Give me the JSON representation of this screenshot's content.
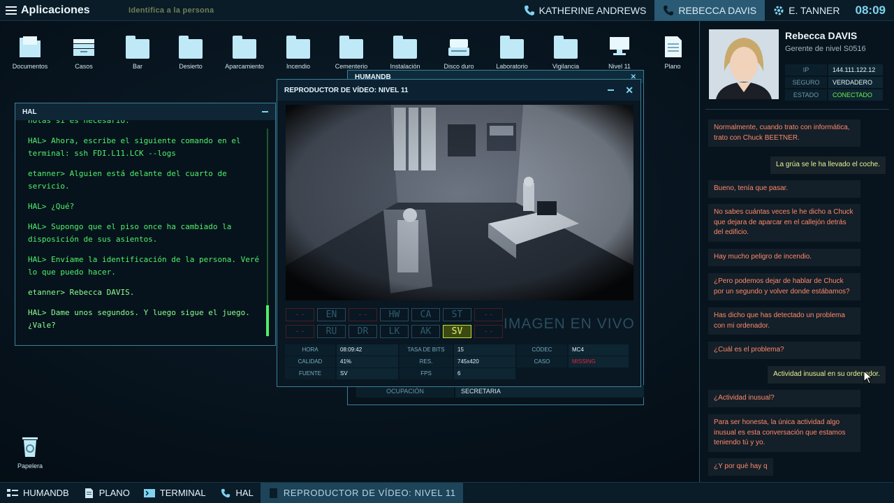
{
  "topbar": {
    "apps_label": "Aplicaciones",
    "hint": "Identifica a la persona",
    "contacts": [
      {
        "name": "KATHERINE ANDREWS",
        "active": false
      },
      {
        "name": "REBECCA DAVIS",
        "active": true
      },
      {
        "name": "E. TANNER",
        "active": false
      }
    ],
    "clock": "08:09"
  },
  "desktop_icons": [
    {
      "label": "Documentos",
      "icon": "documents-folder-icon"
    },
    {
      "label": "Casos",
      "icon": "cases-tray-icon"
    },
    {
      "label": "Bar",
      "icon": "folder-icon"
    },
    {
      "label": "Desierto",
      "icon": "folder-icon"
    },
    {
      "label": "Aparcamiento",
      "icon": "folder-icon"
    },
    {
      "label": "Incendio",
      "icon": "folder-icon"
    },
    {
      "label": "Cementerio",
      "icon": "folder-icon"
    },
    {
      "label": "Instalación",
      "icon": "folder-icon"
    },
    {
      "label": "Disco duro",
      "icon": "hard-drive-icon"
    },
    {
      "label": "Laboratorio",
      "icon": "folder-icon"
    },
    {
      "label": "Vigilancia",
      "icon": "folder-icon"
    },
    {
      "label": "Nivel 11",
      "icon": "monitor-icon"
    },
    {
      "label": "Plano",
      "icon": "document-icon"
    }
  ],
  "recycle": {
    "label": "Papelera"
  },
  "hal": {
    "title": "HAL",
    "lines": [
      {
        "text": "notas si es necesario.",
        "bright": false
      },
      {
        "text": "HAL> Ahora, escribe el siguiente comando en el terminal: ssh FDI.L11.LCK --logs",
        "bright": false
      },
      {
        "text": "etanner> Alguien está delante del cuarto de servicio.",
        "bright": false
      },
      {
        "text": "HAL> ¿Qué?",
        "bright": false
      },
      {
        "text": "HAL> Supongo que el piso once ha cambiado la disposición de sus asientos.",
        "bright": false
      },
      {
        "text": "HAL> Envíame la identificación de la persona. Veré lo que puedo hacer.",
        "bright": false
      },
      {
        "text": "etanner> Rebecca DAVIS.",
        "bright": true
      },
      {
        "text": "HAL> Dame unos segundos. Y luego sigue el juego. ¿Vale?",
        "bright": true
      }
    ]
  },
  "humandb_behind": {
    "title": "HUMANDB",
    "row_label": "OCUPACIÓN",
    "row_value": "SECRETARIA"
  },
  "video": {
    "title": "REPRODUCTOR DE VÍDEO: NIVEL 11",
    "live_label": "IMAGEN EN VIVO",
    "cams_row1": [
      {
        "label": "--",
        "state": "red"
      },
      {
        "label": "EN",
        "state": "off"
      },
      {
        "label": "--",
        "state": "red"
      },
      {
        "label": "HW",
        "state": "off"
      },
      {
        "label": "CA",
        "state": "off"
      },
      {
        "label": "ST",
        "state": "off"
      },
      {
        "label": "--",
        "state": "red"
      }
    ],
    "cams_row2": [
      {
        "label": "--",
        "state": "red"
      },
      {
        "label": "RU",
        "state": "off"
      },
      {
        "label": "DR",
        "state": "off"
      },
      {
        "label": "LK",
        "state": "off"
      },
      {
        "label": "AK",
        "state": "off"
      },
      {
        "label": "SV",
        "state": "sel"
      },
      {
        "label": "--",
        "state": "red"
      }
    ],
    "info": [
      [
        {
          "k": "HORA",
          "v": "08:09:42"
        },
        {
          "k": "TASA DE BITS",
          "v": "15"
        },
        {
          "k": "CÓDEC",
          "v": "MC4"
        }
      ],
      [
        {
          "k": "CALIDAD",
          "v": "41%"
        },
        {
          "k": "RES.",
          "v": "745x420"
        },
        {
          "k": "CASO",
          "v": "MISSING"
        }
      ],
      [
        {
          "k": "FUENTE",
          "v": "SV"
        },
        {
          "k": "FPS",
          "v": "6"
        }
      ]
    ]
  },
  "profile": {
    "name": "Rebecca DAVIS",
    "role": "Gerente de nivel S0516",
    "fields": [
      {
        "k": "IP",
        "v": "144.111.122.12"
      },
      {
        "k": "SEGURO",
        "v": "VERDADERO"
      },
      {
        "k": "ESTADO",
        "v": "CONECTADO"
      }
    ]
  },
  "chat": [
    {
      "from": "them",
      "text": "Normalmente, cuando trato con informática, trato con Chuck BEETNER."
    },
    {
      "from": "me",
      "text": "La grúa se le ha llevado el coche."
    },
    {
      "from": "them",
      "text": "Bueno, tenía que pasar."
    },
    {
      "from": "them",
      "text": "No sabes cuántas veces le he dicho a Chuck que dejara de aparcar en el callejón detrás del edificio."
    },
    {
      "from": "them",
      "text": "Hay mucho peligro de incendio."
    },
    {
      "from": "them",
      "text": "¿Pero podemos dejar de hablar de Chuck por un segundo y volver donde estábamos?"
    },
    {
      "from": "them",
      "text": "Has dicho que has detectado un problema con mi ordenador."
    },
    {
      "from": "them",
      "text": "¿Cuál es el problema?"
    },
    {
      "from": "me",
      "text": "Actividad inusual en su ordenador."
    },
    {
      "from": "them",
      "text": "¿Actividad inusual?"
    },
    {
      "from": "them",
      "text": "Para ser honesta, la única actividad algo inusual es esta conversación que estamos teniendo tú y yo."
    },
    {
      "from": "them",
      "text": "¿Y por qué hay q"
    }
  ],
  "taskbar": [
    {
      "label": "HUMANDB",
      "icon": "humandb-icon",
      "active": false
    },
    {
      "label": "PLANO",
      "icon": "document-icon",
      "active": false
    },
    {
      "label": "TERMINAL",
      "icon": "terminal-icon",
      "active": false
    },
    {
      "label": "HAL",
      "icon": "phone-icon",
      "active": false
    },
    {
      "label": "REPRODUCTOR DE VÍDEO: NIVEL 11",
      "icon": "video-icon",
      "active": true
    }
  ],
  "colors": {
    "accent": "#3d7f99",
    "hal_text": "#4ff06a",
    "chat_them": "#ff8a6a",
    "chat_me": "#e8f296",
    "missing": "#e0263a",
    "connected": "#6cf04a"
  }
}
